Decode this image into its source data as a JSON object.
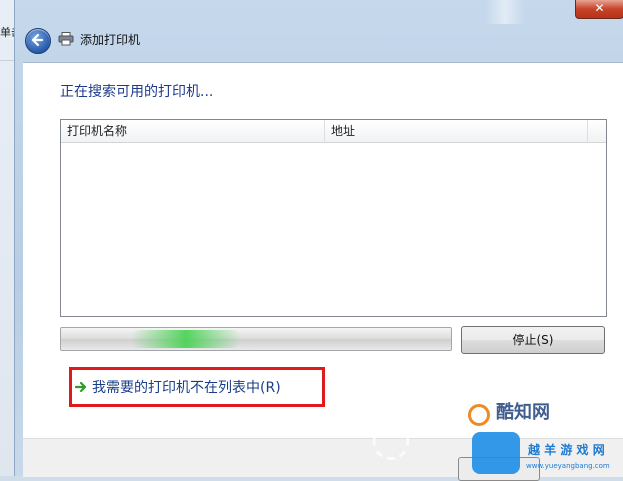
{
  "background": {
    "partial_text": "单击"
  },
  "window": {
    "title": "添加打印机",
    "close_glyph": "✕"
  },
  "content": {
    "heading": "正在搜索可用的打印机...",
    "list": {
      "columns": [
        "打印机名称",
        "地址"
      ],
      "rows": []
    },
    "progress": {
      "state": "indeterminate",
      "glow_position_fraction": 0.18
    },
    "stop_button_label": "停止(S)",
    "not_listed_link": "我需要的打印机不在列表中(R)",
    "highlight_color": "#e0191d"
  },
  "watermarks": {
    "wm1_text": "酷知网",
    "wm2_text": "越 羊 游 戏 网",
    "wm2_url": "www.yueyangbang.com"
  },
  "colors": {
    "heading": "#1e3b8a",
    "link": "#1a3e88",
    "progress_glow": "#46d250"
  },
  "icons": {
    "back": "back-arrow-icon",
    "printer": "printer-icon",
    "link_arrow": "green-arrow-icon"
  }
}
